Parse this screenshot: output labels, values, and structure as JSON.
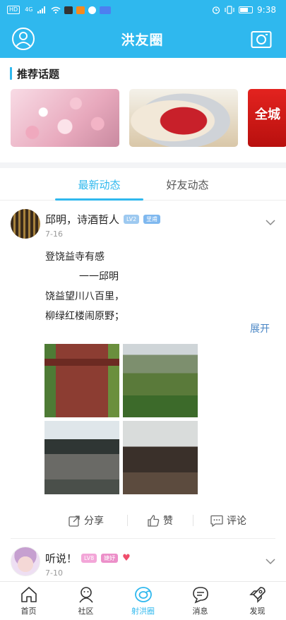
{
  "status_bar": {
    "network": "HD",
    "signal": "4G",
    "time": "9:38"
  },
  "header": {
    "title": "洪友圈",
    "profile_icon": "user-circle-icon",
    "camera_icon": "camera-icon"
  },
  "topics": {
    "title": "推荐话题",
    "cards": [
      {
        "name": "cherry-blossom"
      },
      {
        "name": "hotpot"
      },
      {
        "name": "promo",
        "text": "全城"
      }
    ]
  },
  "tabs": {
    "latest": "最新动态",
    "friends": "好友动态",
    "active": "latest"
  },
  "post": {
    "author": "邱明，诗酒哲人",
    "level_badge": "LV2",
    "role_badge": "里甫",
    "date": "7-16",
    "lines": [
      "登饶益寺有感",
      "一一邱明",
      "饶益望川八百里，",
      "柳绿红楼闹原野；"
    ],
    "expand": "展开",
    "actions": {
      "share": "分享",
      "like": "赞",
      "comment": "评论"
    }
  },
  "post2": {
    "author": "听说！",
    "level_badge": "LV8",
    "role_badge": "婕妤",
    "date": "7-10"
  },
  "bottom_nav": [
    {
      "label": "首页",
      "icon": "home-icon"
    },
    {
      "label": "社区",
      "icon": "community-icon"
    },
    {
      "label": "射洪圈",
      "icon": "circle-icon",
      "active": true
    },
    {
      "label": "消息",
      "icon": "message-icon"
    },
    {
      "label": "发现",
      "icon": "rocket-icon"
    }
  ],
  "colors": {
    "brand": "#2fb8ee",
    "link": "#4a86c5"
  }
}
